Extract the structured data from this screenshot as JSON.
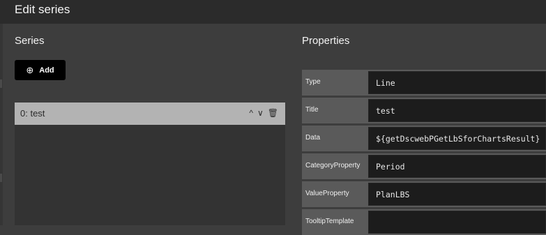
{
  "dialog": {
    "title": "Edit series"
  },
  "series_panel": {
    "heading": "Series",
    "add_label": "Add",
    "add_icon": "plus-circle-icon",
    "items": [
      {
        "label": "0: test",
        "up_icon": "^",
        "down_icon": "∨",
        "delete_icon": "🗑"
      }
    ]
  },
  "properties_panel": {
    "heading": "Properties",
    "rows": [
      {
        "name": "Type",
        "value": "Line"
      },
      {
        "name": "Title",
        "value": "test"
      },
      {
        "name": "Data",
        "value": "${getDscwebPGetLbSforChartsResult}"
      },
      {
        "name": "CategoryProperty",
        "value": "Period"
      },
      {
        "name": "ValueProperty",
        "value": "PlanLBS"
      },
      {
        "name": "TooltipTemplate",
        "value": ""
      }
    ]
  },
  "colors": {
    "row_selected": "#b3b3b3",
    "value_bg": "#1c1c1c",
    "add_button_bg": "#000000"
  }
}
